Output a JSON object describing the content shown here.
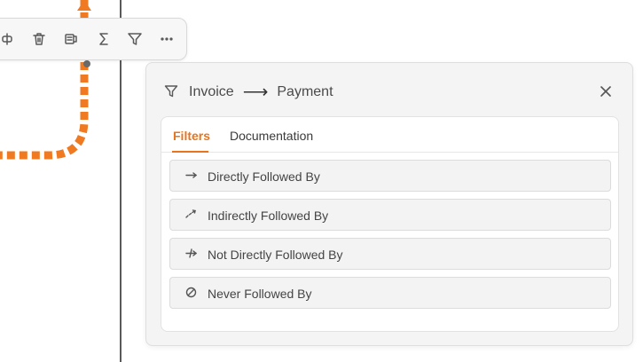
{
  "colors": {
    "accent": "#e8741e",
    "edge": "#f07a22",
    "divider": "#5a5a5a"
  },
  "toolbar": {
    "items": [
      {
        "icon": "split-node-icon"
      },
      {
        "icon": "trash-icon"
      },
      {
        "icon": "replace-icon"
      },
      {
        "icon": "sigma-icon"
      },
      {
        "icon": "filter-icon"
      },
      {
        "icon": "more-icon"
      }
    ]
  },
  "panel": {
    "header": {
      "icon": "filter-icon",
      "from": "Invoice",
      "arrow": "⟶",
      "to": "Payment"
    },
    "tabs": [
      {
        "label": "Filters",
        "active": true
      },
      {
        "label": "Documentation",
        "active": false
      }
    ],
    "filters": [
      {
        "icon": "arrow-right-icon",
        "label": "Directly Followed By"
      },
      {
        "icon": "dotted-arrow-icon",
        "label": "Indirectly Followed By"
      },
      {
        "icon": "crossed-arrow-icon",
        "label": "Not Directly Followed By"
      },
      {
        "icon": "prohibited-icon",
        "label": "Never Followed By"
      }
    ]
  }
}
